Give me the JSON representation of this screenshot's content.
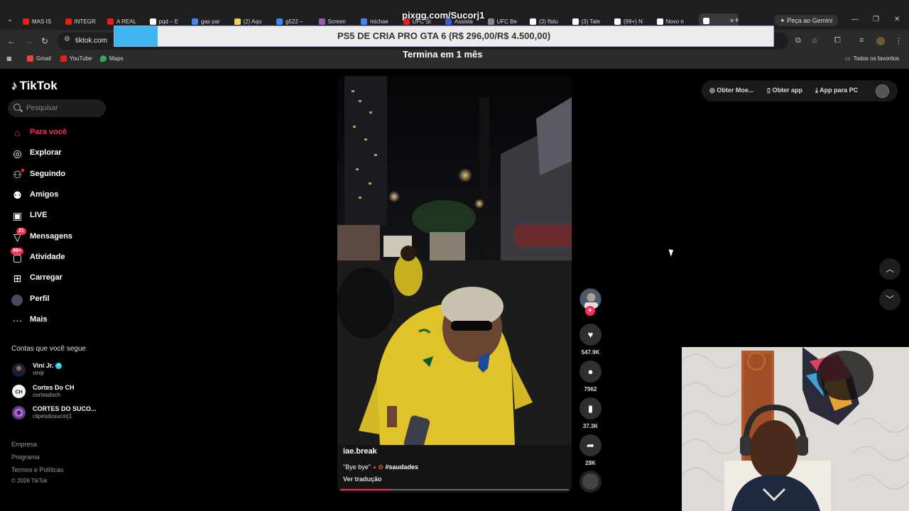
{
  "browser": {
    "tabs": [
      {
        "label": "MAS IS",
        "color": "#e62117"
      },
      {
        "label": "INTEGR",
        "color": "#e62117"
      },
      {
        "label": "A REAL",
        "color": "#e62117"
      },
      {
        "label": "pqd – E",
        "color": "#ffffff"
      },
      {
        "label": "gas par",
        "color": "#4285f4"
      },
      {
        "label": "(2) Aqu",
        "color": "#f0d060"
      },
      {
        "label": "g522 – ",
        "color": "#4285f4"
      },
      {
        "label": "Screen",
        "color": "#9b59b6"
      },
      {
        "label": "michae",
        "color": "#4285f4"
      },
      {
        "label": "UFC St",
        "color": "#e62117"
      },
      {
        "label": "Assista",
        "color": "#3b5bdb"
      },
      {
        "label": "UFC Be",
        "color": "#888888"
      },
      {
        "label": "(3) flstu",
        "color": "#ffffff"
      },
      {
        "label": "(3) Tale",
        "color": "#ffffff"
      },
      {
        "label": "(99+) N",
        "color": "#ffffff"
      },
      {
        "label": "Novo n",
        "color": "#ffffff"
      },
      {
        "label": "",
        "color": "#ffffff"
      }
    ],
    "gemini_label": "Peça ao Gemini",
    "url": "tiktok.com",
    "bookmarks": [
      "Gmail",
      "YouTube",
      "Maps"
    ],
    "all_bookmarks": "Todos os favoritos"
  },
  "overlay": {
    "title": "pixgg.com/Sucorj1",
    "goal_text": "PS5 DE CRIA PRO GTA 6 (R$ 296,00/R$ 4.500,00)",
    "goal_progress_pct": 6.6,
    "ends_in": "Termina em 1 mês"
  },
  "tiktok": {
    "logo": "TikTok",
    "search_placeholder": "Pesquisar",
    "nav": [
      {
        "label": "Para você",
        "icon": "home-icon"
      },
      {
        "label": "Explorar",
        "icon": "compass-icon"
      },
      {
        "label": "Seguindo",
        "icon": "users-icon"
      },
      {
        "label": "Amigos",
        "icon": "friends-icon"
      },
      {
        "label": "LIVE",
        "icon": "live-icon"
      },
      {
        "label": "Mensagens",
        "icon": "paper-plane-icon",
        "badge": "21"
      },
      {
        "label": "Atividade",
        "icon": "inbox-icon",
        "badge": "99+"
      },
      {
        "label": "Carregar",
        "icon": "upload-icon"
      },
      {
        "label": "Perfil",
        "icon": "avatar"
      },
      {
        "label": "Mais",
        "icon": "more-icon"
      }
    ],
    "following_title": "Contas que você segue",
    "accounts": [
      {
        "name": "Vini Jr.",
        "handle": "vinijr",
        "verified": true
      },
      {
        "name": "Cortes Do CH",
        "handle": "cortesdoch",
        "verified": false
      },
      {
        "name": "CORTES DO SUCO...",
        "handle": "clipesdosucorj1",
        "verified": false
      }
    ],
    "footer": [
      "Empresa",
      "Programa",
      "Termos e Políticas",
      "© 2026 TikTok"
    ],
    "top_actions": [
      "Obter Moe...",
      "Obter app",
      "App para PC"
    ],
    "video": {
      "handle": "iae.break",
      "caption": "\"Bye bye\"",
      "hashtag": "#saudades",
      "translate": "Ver tradução",
      "progress_pct": 22
    },
    "actions": {
      "likes": "547.9K",
      "comments": "7962",
      "saves": "37.3K",
      "shares": "28K"
    }
  }
}
